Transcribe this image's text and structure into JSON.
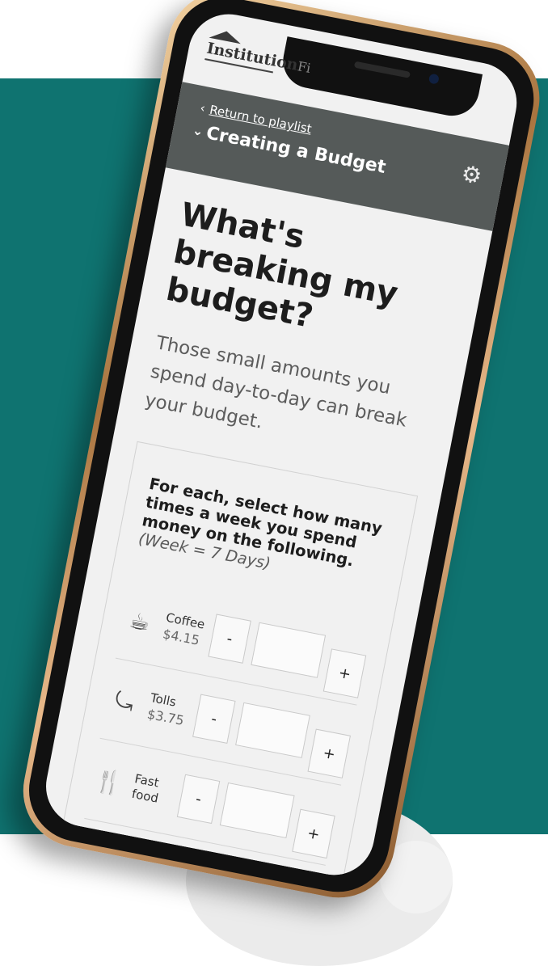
{
  "brand": {
    "name": "Institution",
    "suffix": "Fi"
  },
  "header": {
    "back_icon": "chevron-left",
    "return_label": "Return to playlist",
    "collapse_icon": "chevron-down",
    "course_title": "Creating a Budget",
    "settings_icon": "gear"
  },
  "page": {
    "heading": "What's breaking my budget?",
    "intro": "Those small amounts you spend day-to-day can break your budget."
  },
  "card": {
    "instruction": "For each, select how many times a week you spend money on the following.",
    "note": "(Week = 7 Days)"
  },
  "items": [
    {
      "name": "Coffee",
      "price": "$4.15",
      "icon": "coffee-cup",
      "minus": "-",
      "plus": "+",
      "value": ""
    },
    {
      "name": "Tolls",
      "price": "$3.75",
      "icon": "road",
      "minus": "-",
      "plus": "+",
      "value": ""
    },
    {
      "name": "Fast food",
      "price": "",
      "icon": "fork-knife",
      "minus": "-",
      "plus": "+",
      "value": ""
    }
  ],
  "colors": {
    "teal_background": "#0f7370",
    "app_bar": "#555a59",
    "phone_frame_gold": "#c8955f"
  }
}
